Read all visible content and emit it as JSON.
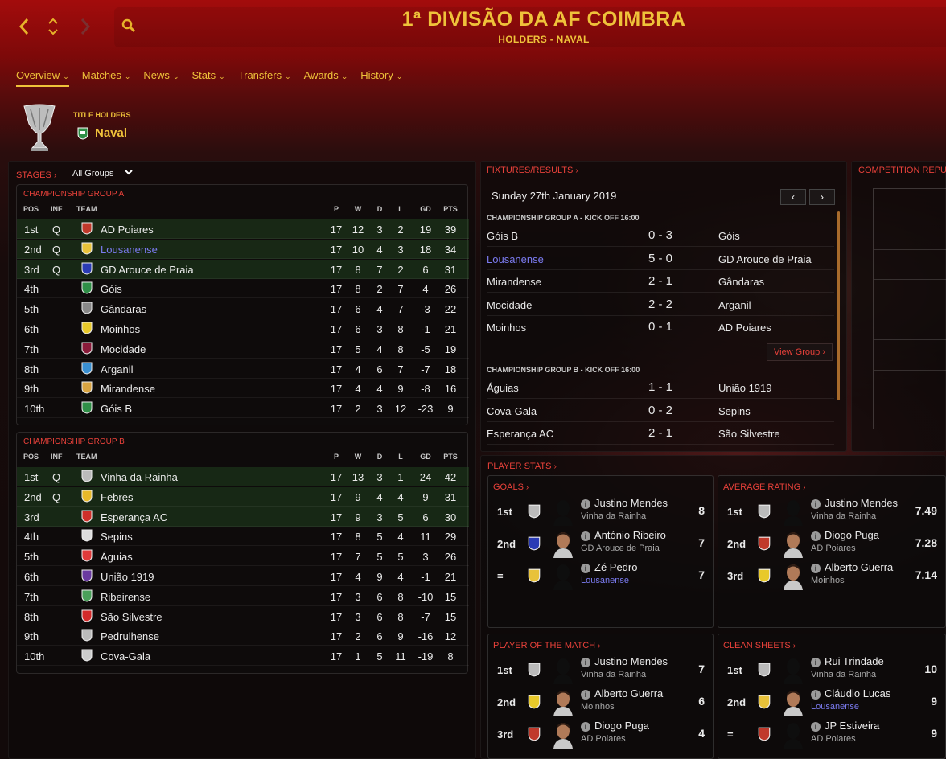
{
  "header": {
    "title": "1ª DIVISÃO DA AF COIMBRA",
    "subtitle": "HOLDERS - NAVAL",
    "accent": "#efc23a"
  },
  "nav": {
    "back": "‹",
    "updown": "⌃⌄",
    "forward": "›"
  },
  "tabs": [
    {
      "label": "Overview",
      "active": true
    },
    {
      "label": "Matches"
    },
    {
      "label": "News"
    },
    {
      "label": "Stats"
    },
    {
      "label": "Transfers"
    },
    {
      "label": "Awards"
    },
    {
      "label": "History"
    }
  ],
  "holders": {
    "label": "TITLE HOLDERS",
    "team": "Naval"
  },
  "stages": {
    "title": "STAGES",
    "select": "All Groups"
  },
  "table_headers": {
    "pos": "POS",
    "inf": "INF",
    "team": "TEAM",
    "p": "P",
    "w": "W",
    "d": "D",
    "l": "L",
    "gd": "GD",
    "pts": "PTS"
  },
  "groups": [
    {
      "title": "CHAMPIONSHIP GROUP A",
      "rows": [
        {
          "pos": "1st",
          "inf": "Q",
          "team": "AD Poiares",
          "p": "17",
          "w": "12",
          "d": "3",
          "l": "2",
          "gd": "19",
          "pts": "39",
          "color": "#c0392b"
        },
        {
          "pos": "2nd",
          "inf": "Q",
          "team": "Lousanense",
          "p": "17",
          "w": "10",
          "d": "4",
          "l": "3",
          "gd": "18",
          "pts": "34",
          "color": "#e8c23a",
          "highlight": true
        },
        {
          "pos": "3rd",
          "inf": "Q",
          "team": "GD Arouce de Praia",
          "p": "17",
          "w": "8",
          "d": "7",
          "l": "2",
          "gd": "6",
          "pts": "31",
          "color": "#2a3bb5"
        },
        {
          "pos": "4th",
          "inf": "",
          "team": "Góis",
          "p": "17",
          "w": "8",
          "d": "2",
          "l": "7",
          "gd": "4",
          "pts": "26",
          "color": "#2f8f47"
        },
        {
          "pos": "5th",
          "inf": "",
          "team": "Gândaras",
          "p": "17",
          "w": "6",
          "d": "4",
          "l": "7",
          "gd": "-3",
          "pts": "22",
          "color": "#888888"
        },
        {
          "pos": "6th",
          "inf": "",
          "team": "Moinhos",
          "p": "17",
          "w": "6",
          "d": "3",
          "l": "8",
          "gd": "-1",
          "pts": "21",
          "color": "#e8c92a"
        },
        {
          "pos": "7th",
          "inf": "",
          "team": "Mocidade",
          "p": "17",
          "w": "5",
          "d": "4",
          "l": "8",
          "gd": "-5",
          "pts": "19",
          "color": "#8a1b3a"
        },
        {
          "pos": "8th",
          "inf": "",
          "team": "Arganil",
          "p": "17",
          "w": "4",
          "d": "6",
          "l": "7",
          "gd": "-7",
          "pts": "18",
          "color": "#3a8fd0"
        },
        {
          "pos": "9th",
          "inf": "",
          "team": "Mirandense",
          "p": "17",
          "w": "4",
          "d": "4",
          "l": "9",
          "gd": "-8",
          "pts": "16",
          "color": "#d9a441"
        },
        {
          "pos": "10th",
          "inf": "",
          "team": "Góis B",
          "p": "17",
          "w": "2",
          "d": "3",
          "l": "12",
          "gd": "-23",
          "pts": "9",
          "color": "#2f8f47"
        }
      ]
    },
    {
      "title": "CHAMPIONSHIP GROUP B",
      "rows": [
        {
          "pos": "1st",
          "inf": "Q",
          "team": "Vinha da Rainha",
          "p": "17",
          "w": "13",
          "d": "3",
          "l": "1",
          "gd": "24",
          "pts": "42",
          "color": "#bbbbbb"
        },
        {
          "pos": "2nd",
          "inf": "Q",
          "team": "Febres",
          "p": "17",
          "w": "9",
          "d": "4",
          "l": "4",
          "gd": "9",
          "pts": "31",
          "color": "#e8b92a"
        },
        {
          "pos": "3rd",
          "inf": "",
          "team": "Esperança AC",
          "p": "17",
          "w": "9",
          "d": "3",
          "l": "5",
          "gd": "6",
          "pts": "30",
          "color": "#d0302a"
        },
        {
          "pos": "4th",
          "inf": "",
          "team": "Sepins",
          "p": "17",
          "w": "8",
          "d": "5",
          "l": "4",
          "gd": "11",
          "pts": "29",
          "color": "#dddddd"
        },
        {
          "pos": "5th",
          "inf": "",
          "team": "Águias",
          "p": "17",
          "w": "7",
          "d": "5",
          "l": "5",
          "gd": "3",
          "pts": "26",
          "color": "#e03a3a"
        },
        {
          "pos": "6th",
          "inf": "",
          "team": "União 1919",
          "p": "17",
          "w": "4",
          "d": "9",
          "l": "4",
          "gd": "-1",
          "pts": "21",
          "color": "#6a3aa0"
        },
        {
          "pos": "7th",
          "inf": "",
          "team": "Ribeirense",
          "p": "17",
          "w": "3",
          "d": "6",
          "l": "8",
          "gd": "-10",
          "pts": "15",
          "color": "#4aa05a"
        },
        {
          "pos": "8th",
          "inf": "",
          "team": "São Silvestre",
          "p": "17",
          "w": "3",
          "d": "6",
          "l": "8",
          "gd": "-7",
          "pts": "15",
          "color": "#d42a2a"
        },
        {
          "pos": "9th",
          "inf": "",
          "team": "Pedrulhense",
          "p": "17",
          "w": "2",
          "d": "6",
          "l": "9",
          "gd": "-16",
          "pts": "12",
          "color": "#bbbbbb"
        },
        {
          "pos": "10th",
          "inf": "",
          "team": "Cova-Gala",
          "p": "17",
          "w": "1",
          "d": "5",
          "l": "11",
          "gd": "-19",
          "pts": "8",
          "color": "#cccccc"
        }
      ]
    }
  ],
  "fixtures": {
    "title": "FIXTURES/RESULTS",
    "date": "Sunday 27th January 2019",
    "view_group": "View Group",
    "sections": [
      {
        "header": "CHAMPIONSHIP GROUP A - KICK OFF 16:00",
        "matches": [
          {
            "home": "Góis B",
            "score": "0 - 3",
            "away": "Góis"
          },
          {
            "home": "Lousanense",
            "score": "5 - 0",
            "away": "GD Arouce de Praia",
            "home_highlight": true
          },
          {
            "home": "Mirandense",
            "score": "2 - 1",
            "away": "Gândaras"
          },
          {
            "home": "Mocidade",
            "score": "2 - 2",
            "away": "Arganil"
          },
          {
            "home": "Moinhos",
            "score": "0 - 1",
            "away": "AD Poiares"
          }
        ]
      },
      {
        "header": "CHAMPIONSHIP GROUP B - KICK OFF 16:00",
        "matches": [
          {
            "home": "Águias",
            "score": "1 - 1",
            "away": "União 1919"
          },
          {
            "home": "Cova-Gala",
            "score": "0 - 2",
            "away": "Sepins"
          },
          {
            "home": "Esperança AC",
            "score": "2 - 1",
            "away": "São Silvestre"
          }
        ]
      }
    ]
  },
  "reputation": {
    "title": "COMPETITION REPUTA"
  },
  "player_stats": {
    "title": "PLAYER STATS",
    "boxes": [
      {
        "title": "GOALS",
        "rows": [
          {
            "rank": "1st",
            "name": "Justino Mendes",
            "club": "Vinha da Rainha",
            "value": "8",
            "dark": true,
            "club_color": "#bbbbbb"
          },
          {
            "rank": "2nd",
            "name": "António Ribeiro",
            "club": "GD Arouce de Praia",
            "value": "7",
            "club_color": "#2a3bb5"
          },
          {
            "rank": "=",
            "name": "Zé Pedro",
            "club": "Lousanense",
            "value": "7",
            "dark": true,
            "club_blue": true,
            "club_color": "#e8c23a"
          }
        ]
      },
      {
        "title": "AVERAGE RATING",
        "rows": [
          {
            "rank": "1st",
            "name": "Justino Mendes",
            "club": "Vinha da Rainha",
            "value": "7.49",
            "dark": true,
            "club_color": "#bbbbbb"
          },
          {
            "rank": "2nd",
            "name": "Diogo Puga",
            "club": "AD Poiares",
            "value": "7.28",
            "club_color": "#c0392b"
          },
          {
            "rank": "3rd",
            "name": "Alberto Guerra",
            "club": "Moinhos",
            "value": "7.14",
            "club_color": "#e8c92a"
          }
        ]
      },
      {
        "title": "PLAYER OF THE MATCH",
        "rows": [
          {
            "rank": "1st",
            "name": "Justino Mendes",
            "club": "Vinha da Rainha",
            "value": "7",
            "dark": true,
            "club_color": "#bbbbbb"
          },
          {
            "rank": "2nd",
            "name": "Alberto Guerra",
            "club": "Moinhos",
            "value": "6",
            "club_color": "#e8c92a"
          },
          {
            "rank": "3rd",
            "name": "Diogo Puga",
            "club": "AD Poiares",
            "value": "4",
            "club_color": "#c0392b"
          }
        ]
      },
      {
        "title": "CLEAN SHEETS",
        "rows": [
          {
            "rank": "1st",
            "name": "Rui Trindade",
            "club": "Vinha da Rainha",
            "value": "10",
            "dark": true,
            "club_color": "#bbbbbb"
          },
          {
            "rank": "2nd",
            "name": "Cláudio Lucas",
            "club": "Lousanense",
            "value": "9",
            "club_blue": true,
            "club_color": "#e8c23a"
          },
          {
            "rank": "=",
            "name": "JP Estiveira",
            "club": "AD Poiares",
            "value": "9",
            "dark": true,
            "club_color": "#c0392b"
          }
        ]
      }
    ]
  }
}
